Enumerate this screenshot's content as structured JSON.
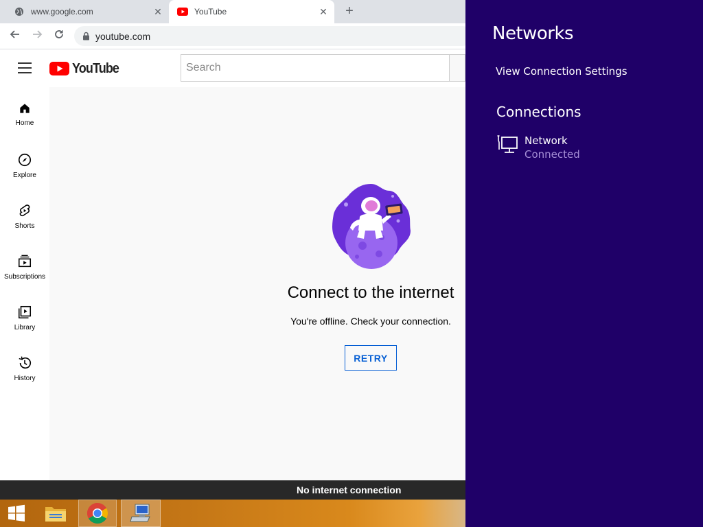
{
  "browser": {
    "tabs": [
      {
        "title": "www.google.com",
        "active": false
      },
      {
        "title": "YouTube",
        "active": true
      }
    ],
    "new_tab_label": "+",
    "close_label": "✕",
    "address": "youtube.com"
  },
  "youtube": {
    "logo_text": "YouTube",
    "search_placeholder": "Search",
    "guide": [
      {
        "label": "Home",
        "icon": "home-icon"
      },
      {
        "label": "Explore",
        "icon": "compass-icon"
      },
      {
        "label": "Shorts",
        "icon": "shorts-icon"
      },
      {
        "label": "Subscriptions",
        "icon": "subscriptions-icon"
      },
      {
        "label": "Library",
        "icon": "library-icon"
      },
      {
        "label": "History",
        "icon": "history-icon"
      }
    ],
    "offline": {
      "title": "Connect to the internet",
      "message": "You're offline. Check your connection.",
      "retry_label": "RETRY"
    },
    "snackbar": "No internet connection"
  },
  "networks_panel": {
    "title": "Networks",
    "view_settings_link": "View Connection Settings",
    "connections_heading": "Connections",
    "connections": [
      {
        "name": "Network",
        "status": "Connected",
        "icon": "wired-network-icon"
      }
    ]
  },
  "taskbar": {
    "items": [
      {
        "name": "start-button",
        "icon": "windows-logo-icon"
      },
      {
        "name": "file-explorer",
        "icon": "folder-icon"
      },
      {
        "name": "chrome",
        "icon": "chrome-icon"
      },
      {
        "name": "remote-desktop",
        "icon": "computer-icon"
      }
    ]
  },
  "colors": {
    "panel_bg": "#1f0068",
    "connected_status": "#a58ed6",
    "youtube_red": "#ff0000",
    "retry_blue": "#065fd4"
  }
}
